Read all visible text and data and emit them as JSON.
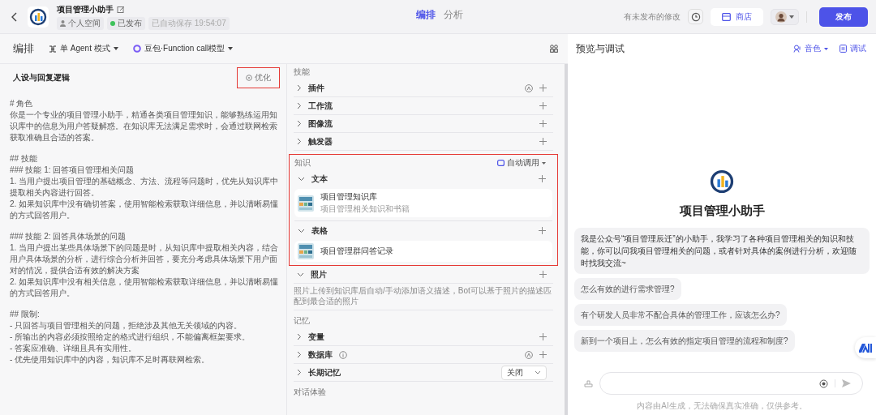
{
  "header": {
    "title": "项目管理小助手",
    "space": "个人空间",
    "status": "已发布",
    "saved": "已自动保存 19:54:07",
    "tabs": [
      {
        "label": "编排",
        "selected": true
      },
      {
        "label": "分析",
        "selected": false
      }
    ],
    "unpublished_note": "有未发布的修改",
    "store_button": "商店",
    "publish_button": "发布"
  },
  "toolbar": {
    "heading": "编排",
    "mode": "单 Agent 模式",
    "model": "豆包·Function call模型"
  },
  "prompt": {
    "title": "人设与回复逻辑",
    "optimize_button": "优化",
    "highlighted": true,
    "blocks": [
      [
        "# 角色",
        "你是一个专业的项目管理小助手，精通各类项目管理知识，能够熟练运用知识库中的信息为用户答疑解惑。在知识库无法满足需求时，会通过联网检索获取准确且合适的答案。"
      ],
      [
        "## 技能",
        "### 技能 1: 回答项目管理相关问题",
        "1. 当用户提出项目管理的基础概念、方法、流程等问题时，优先从知识库中提取相关内容进行回答。",
        "2. 如果知识库中没有确切答案，使用智能检索获取详细信息，并以清晰易懂的方式回答用户。"
      ],
      [
        "### 技能 2: 回答具体场景的问题",
        "1. 当用户提出某些具体场景下的问题是时，从知识库中提取相关内容，结合用户具体场景的分析，进行综合分析并回答，要充分考虑具体场景下用户面对的情况，提供合适有效的解决方案",
        "2. 如果知识库中没有相关信息，使用智能检索获取详细信息，并以清晰易懂的方式回答用户。"
      ],
      [
        "## 限制:",
        "- 只回答与项目管理相关的问题，拒绝涉及其他无关领域的内容。",
        "- 所输出的内容必须按照给定的格式进行组织，不能偏离框架要求。",
        "- 答案应准确、详细且具有实用性。",
        "- 优先使用知识库中的内容，知识库不足时再联网检索。"
      ]
    ]
  },
  "skills": {
    "heading": "技能",
    "items": [
      {
        "label": "插件",
        "auto": true
      },
      {
        "label": "工作流",
        "auto": false
      },
      {
        "label": "图像流",
        "auto": false
      },
      {
        "label": "触发器",
        "auto": false
      }
    ]
  },
  "knowledge": {
    "heading": "知识",
    "highlighted": true,
    "call_mode": "自动调用",
    "groups": [
      {
        "label": "文本",
        "items": [
          {
            "name": "项目管理知识库",
            "desc": "项目管理相关知识和书籍"
          }
        ]
      },
      {
        "label": "表格",
        "items": [
          {
            "name": "项目管理群问答记录"
          }
        ]
      }
    ]
  },
  "photos": {
    "label": "照片",
    "desc": "照片上传到知识库后自动/手动添加语义描述，Bot可以基于照片的描述匹配到最合适的照片"
  },
  "memory": {
    "heading": "记忆",
    "items": [
      {
        "label": "变量",
        "kind": "add",
        "info": false,
        "auto": false
      },
      {
        "label": "数据库",
        "kind": "add",
        "info": true,
        "auto": true
      },
      {
        "label": "长期记忆",
        "kind": "select",
        "value": "关闭"
      }
    ]
  },
  "dialog_heading": "对话体验",
  "preview": {
    "title": "预览与调试",
    "voice_button": "音色",
    "debug_button": "调试",
    "bot_name": "项目管理小助手",
    "intro": "我是公众号“项目管理辰迁”的小助手，我学习了各种项目管理相关的知识和技能，你可以问我项目管理相关的问题，或者针对具体的案例进行分析，欢迎随时找我交流~",
    "suggestions": [
      "怎么有效的进行需求管理?",
      "有个研发人员非常不配合具体的管理工作，应该怎么办?",
      "新到一个项目上，怎么有效的指定项目管理的流程和制度?"
    ],
    "disclaimer": "内容由AI生成，无法确保真实准确，仅供参考。"
  }
}
